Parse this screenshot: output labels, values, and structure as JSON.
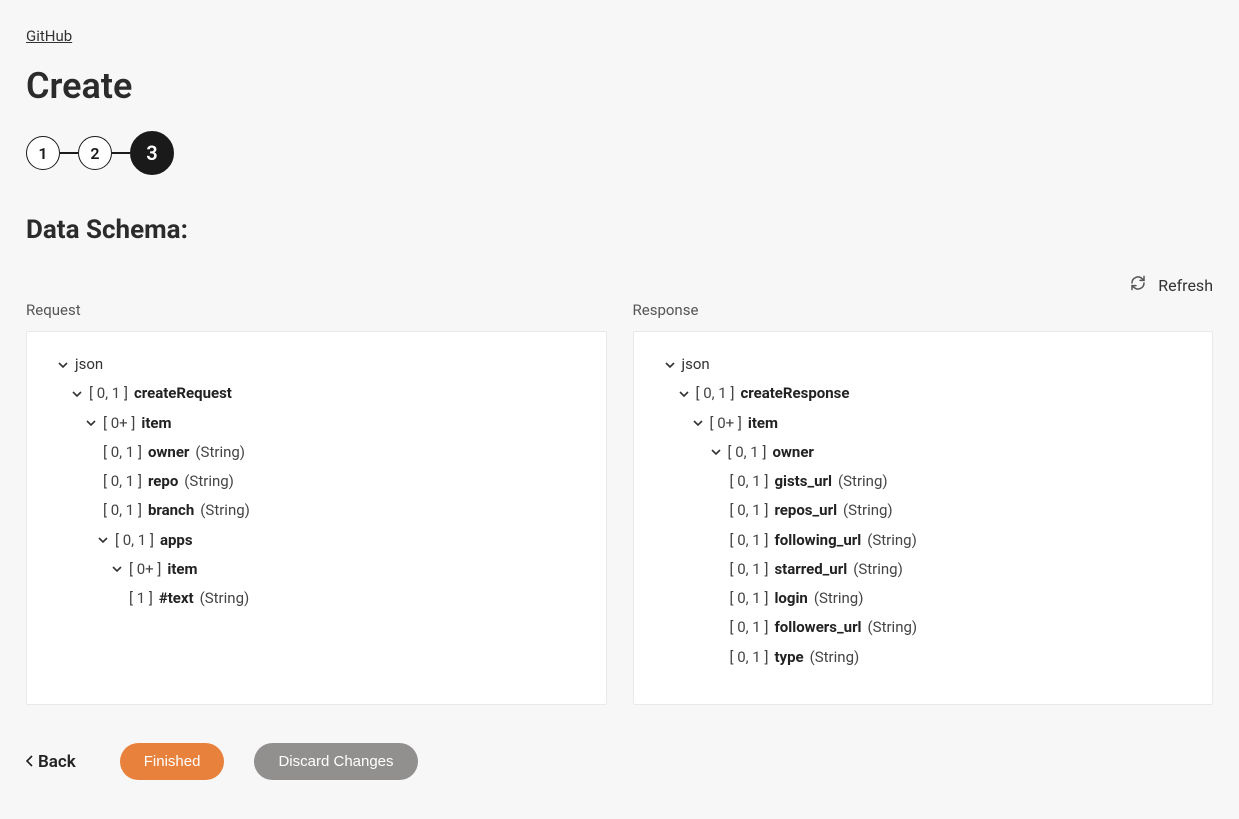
{
  "breadcrumb": {
    "label": "GitHub"
  },
  "title": "Create",
  "steps": {
    "s1": "1",
    "s2": "2",
    "s3": "3"
  },
  "section_title": "Data Schema:",
  "refresh_label": "Refresh",
  "columns": {
    "request": "Request",
    "response": "Response"
  },
  "request_tree": {
    "root": "json",
    "l1_card": "[ 0, 1 ]",
    "l1_name": "createRequest",
    "l2_card": "[ 0+ ]",
    "l2_name": "item",
    "owner_card": "[ 0, 1 ]",
    "owner_name": "owner",
    "owner_type": "(String)",
    "repo_card": "[ 0, 1 ]",
    "repo_name": "repo",
    "repo_type": "(String)",
    "branch_card": "[ 0, 1 ]",
    "branch_name": "branch",
    "branch_type": "(String)",
    "apps_card": "[ 0, 1 ]",
    "apps_name": "apps",
    "apps_item_card": "[ 0+ ]",
    "apps_item_name": "item",
    "text_card": "[ 1 ]",
    "text_name": "#text",
    "text_type": "(String)"
  },
  "response_tree": {
    "root": "json",
    "l1_card": "[ 0, 1 ]",
    "l1_name": "createResponse",
    "l2_card": "[ 0+ ]",
    "l2_name": "item",
    "owner_card": "[ 0, 1 ]",
    "owner_name": "owner",
    "fields": [
      {
        "card": "[ 0, 1 ]",
        "name": "gists_url",
        "type": "(String)"
      },
      {
        "card": "[ 0, 1 ]",
        "name": "repos_url",
        "type": "(String)"
      },
      {
        "card": "[ 0, 1 ]",
        "name": "following_url",
        "type": "(String)"
      },
      {
        "card": "[ 0, 1 ]",
        "name": "starred_url",
        "type": "(String)"
      },
      {
        "card": "[ 0, 1 ]",
        "name": "login",
        "type": "(String)"
      },
      {
        "card": "[ 0, 1 ]",
        "name": "followers_url",
        "type": "(String)"
      },
      {
        "card": "[ 0, 1 ]",
        "name": "type",
        "type": "(String)"
      }
    ]
  },
  "footer": {
    "back": "Back",
    "finished": "Finished",
    "discard": "Discard Changes"
  }
}
